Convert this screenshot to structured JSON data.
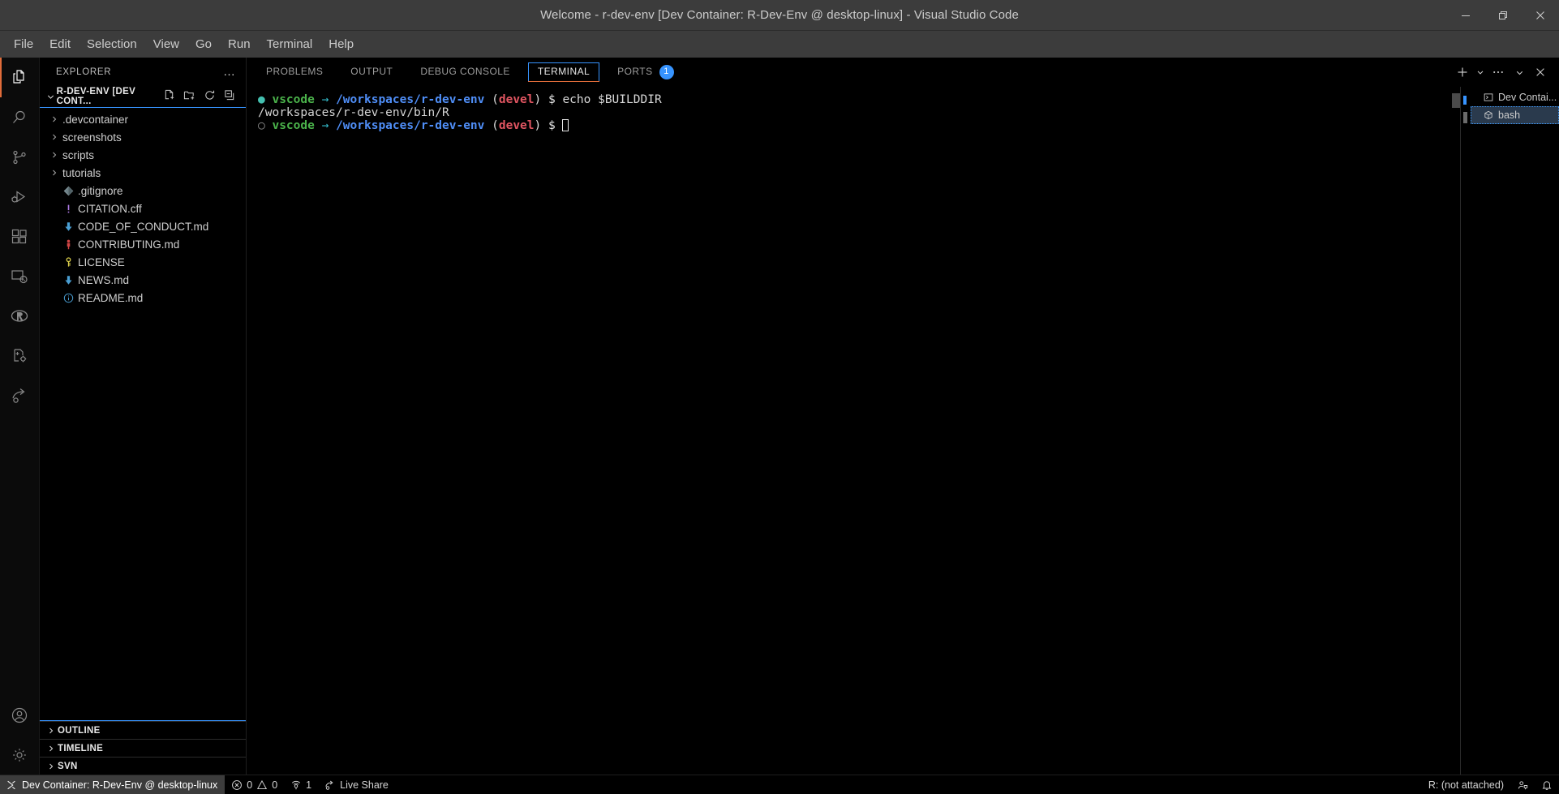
{
  "window": {
    "title": "Welcome - r-dev-env [Dev Container: R-Dev-Env @ desktop-linux] - Visual Studio Code",
    "controls": {
      "minimize": "minimize-icon",
      "restore": "restore-icon",
      "close": "close-icon"
    }
  },
  "menubar": {
    "items": [
      {
        "label": "File"
      },
      {
        "label": "Edit"
      },
      {
        "label": "Selection"
      },
      {
        "label": "View"
      },
      {
        "label": "Go"
      },
      {
        "label": "Run"
      },
      {
        "label": "Terminal"
      },
      {
        "label": "Help"
      }
    ]
  },
  "activitybar": {
    "items": [
      {
        "name": "explorer",
        "icon": "files-icon",
        "active": true
      },
      {
        "name": "search",
        "icon": "search-icon",
        "active": false
      },
      {
        "name": "source-control",
        "icon": "source-control-icon",
        "active": false
      },
      {
        "name": "run-and-debug",
        "icon": "run-debug-icon",
        "active": false
      },
      {
        "name": "extensions",
        "icon": "extensions-icon",
        "active": false
      },
      {
        "name": "remote-explorer",
        "icon": "remote-explorer-icon",
        "active": false
      },
      {
        "name": "r-language",
        "icon": "r-logo-icon",
        "active": false
      },
      {
        "name": "dev-container-config",
        "icon": "container-gear-icon",
        "active": false
      },
      {
        "name": "live-share",
        "icon": "live-share-icon",
        "active": false
      }
    ],
    "bottom": [
      {
        "name": "accounts",
        "icon": "account-icon"
      },
      {
        "name": "manage",
        "icon": "gear-icon"
      }
    ]
  },
  "sidebar": {
    "title": "EXPLORER",
    "more_actions": "…",
    "folder": {
      "label": "R-DEV-ENV [DEV CONT...",
      "actions": [
        {
          "name": "new-file",
          "icon": "new-file-icon"
        },
        {
          "name": "new-folder",
          "icon": "new-folder-icon"
        },
        {
          "name": "refresh",
          "icon": "refresh-icon"
        },
        {
          "name": "collapse-all",
          "icon": "collapse-all-icon"
        }
      ]
    },
    "tree": [
      {
        "label": ".devcontainer",
        "type": "folder",
        "icon": "chevron-right-icon",
        "color": "#a9a9a9"
      },
      {
        "label": "screenshots",
        "type": "folder",
        "icon": "chevron-right-icon",
        "color": "#a9a9a9"
      },
      {
        "label": "scripts",
        "type": "folder",
        "icon": "chevron-right-icon",
        "color": "#a9a9a9"
      },
      {
        "label": "tutorials",
        "type": "folder",
        "icon": "chevron-right-icon",
        "color": "#a9a9a9"
      },
      {
        "label": ".gitignore",
        "type": "file",
        "icon": "git-icon",
        "color": "#6d8086"
      },
      {
        "label": "CITATION.cff",
        "type": "file",
        "icon": "exclamation-icon",
        "color": "#b07ce8"
      },
      {
        "label": "CODE_OF_CONDUCT.md",
        "type": "file",
        "icon": "markdown-arrow-icon",
        "color": "#4a9fd4"
      },
      {
        "label": "CONTRIBUTING.md",
        "type": "file",
        "icon": "person-icon",
        "color": "#d14545"
      },
      {
        "label": "LICENSE",
        "type": "file",
        "icon": "key-icon",
        "color": "#d9cd4a"
      },
      {
        "label": "NEWS.md",
        "type": "file",
        "icon": "markdown-arrow-icon",
        "color": "#4a9fd4"
      },
      {
        "label": "README.md",
        "type": "file",
        "icon": "info-circle-icon",
        "color": "#4a9fd4"
      }
    ],
    "sections": [
      {
        "label": "OUTLINE",
        "expanded": false
      },
      {
        "label": "TIMELINE",
        "expanded": false
      },
      {
        "label": "SVN",
        "expanded": false
      }
    ]
  },
  "panel": {
    "tabs": [
      {
        "label": "PROBLEMS",
        "active": false
      },
      {
        "label": "OUTPUT",
        "active": false
      },
      {
        "label": "DEBUG CONSOLE",
        "active": false
      },
      {
        "label": "TERMINAL",
        "active": true
      },
      {
        "label": "PORTS",
        "active": false,
        "badge": "1"
      }
    ],
    "actions": [
      {
        "name": "new-terminal",
        "icon": "plus-icon"
      },
      {
        "name": "terminal-profile-dropdown",
        "icon": "chevron-down-icon"
      },
      {
        "name": "terminal-views-more",
        "icon": "ellipsis-icon"
      },
      {
        "name": "panel-maximize-dropdown",
        "icon": "chevron-down-icon"
      },
      {
        "name": "close-panel",
        "icon": "close-icon"
      }
    ],
    "terminal": {
      "lines": [
        {
          "type": "prompt-command",
          "status": "active",
          "user": "vscode",
          "arrow": "→",
          "path": "/workspaces/r-dev-env",
          "open_paren": "(",
          "branch": "devel",
          "close_paren": ")",
          "dollar": "$",
          "command": "echo $BUILDDIR"
        },
        {
          "type": "output",
          "text": "/workspaces/r-dev-env/bin/R"
        },
        {
          "type": "prompt",
          "status": "idle",
          "user": "vscode",
          "arrow": "→",
          "path": "/workspaces/r-dev-env",
          "open_paren": "(",
          "branch": "devel",
          "close_paren": ")",
          "dollar": "$",
          "command": ""
        }
      ]
    },
    "terminal_tabs": [
      {
        "label": "Dev Contai...",
        "icon": "terminal-icon",
        "selected": false
      },
      {
        "label": "bash",
        "icon": "cube-icon",
        "selected": true
      }
    ]
  },
  "statusbar": {
    "remote": {
      "label": "Dev Container: R-Dev-Env @ desktop-linux",
      "icon": "remote-icon",
      "bg": "#3c3c3c"
    },
    "left_items": [
      {
        "name": "problems",
        "errors": "0",
        "warnings": "0",
        "error_icon": "error-circle-icon",
        "warning_icon": "warning-triangle-icon"
      },
      {
        "name": "ports",
        "label": "1",
        "icon": "ports-icon"
      },
      {
        "name": "live-share",
        "label": "Live Share",
        "icon": "live-share-icon"
      }
    ],
    "right_items": [
      {
        "name": "r-status",
        "label": "R: (not attached)"
      },
      {
        "name": "feedback",
        "icon": "feedback-icon"
      },
      {
        "name": "notifications",
        "icon": "bell-icon"
      }
    ]
  },
  "colors": {
    "accent_orange": "#e06c3a",
    "accent_blue": "#3794ff",
    "titlebar_bg": "#3c3c3c",
    "editor_bg": "#000000",
    "terminal_green": "#4bb34b",
    "terminal_blue": "#4f8ef7",
    "terminal_red": "#e05561",
    "terminal_cyan": "#35bfcf"
  }
}
